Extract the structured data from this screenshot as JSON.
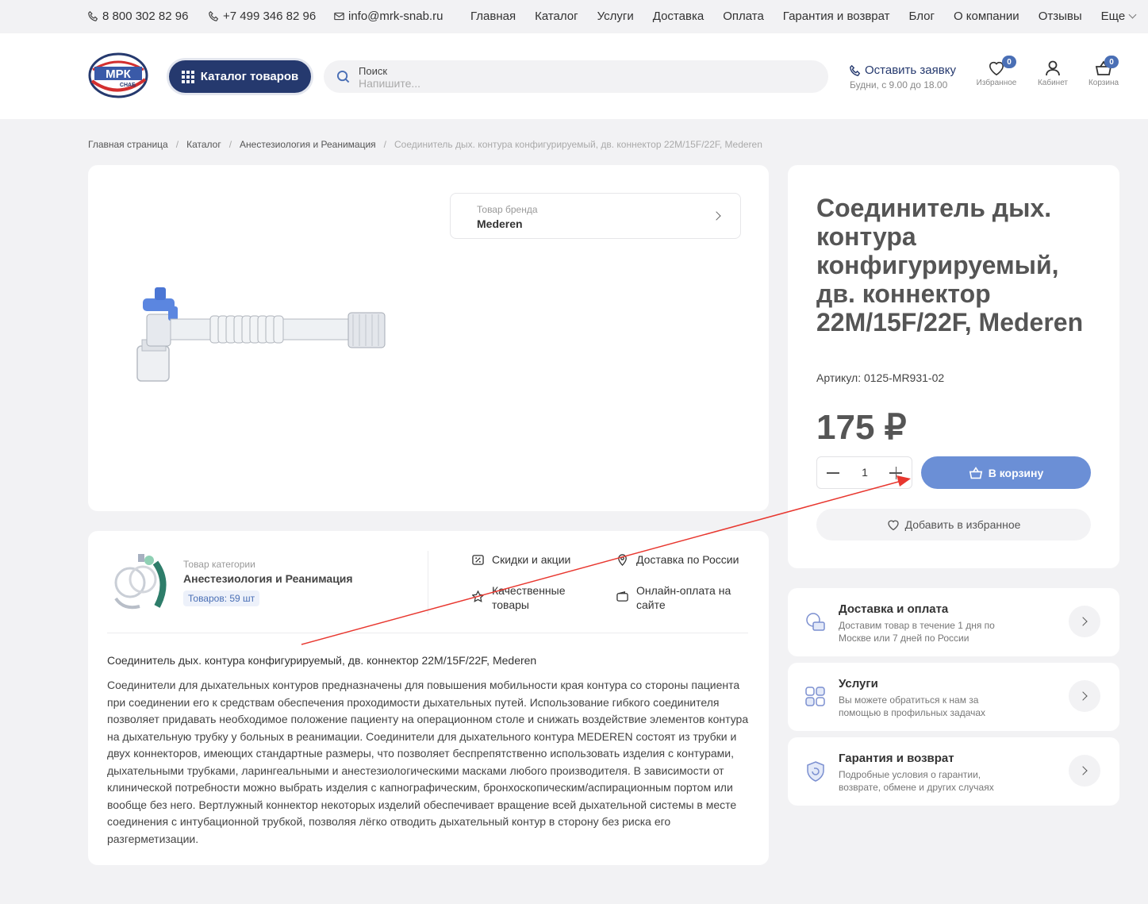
{
  "topbar": {
    "phone1": "8 800 302 82 96",
    "phone2": "+7 499 346 82 96",
    "email": "info@mrk-snab.ru",
    "nav": [
      "Главная",
      "Каталог",
      "Услуги",
      "Доставка",
      "Оплата",
      "Гарантия и возврат",
      "Блог",
      "О компании",
      "Отзывы"
    ],
    "more": "Еще"
  },
  "header": {
    "logo_text_main": "МРК",
    "logo_text_sub": "СНАБ",
    "catalog_button": "Каталог товаров",
    "search_label": "Поиск",
    "search_placeholder": "Напишите...",
    "callback_link": "Оставить заявку",
    "callback_hours": "Будни, с 9.00 до 18.00",
    "favorites_label": "Избранное",
    "favorites_count": "0",
    "account_label": "Кабинет",
    "cart_label": "Корзина",
    "cart_count": "0"
  },
  "breadcrumb": [
    "Главная страница",
    "Каталог",
    "Анестезиология и Реанимация",
    "Соединитель дых. контура конфигурируемый, дв. коннектор 22M/15F/22F, Mederen"
  ],
  "product": {
    "brand_label": "Товар бренда",
    "brand_name": "Mederen",
    "title": "Соединитель дых. контура конфигурируемый, дв. коннектор 22M/15F/22F, Mederen",
    "sku": "Артикул: 0125-MR931-02",
    "price": "175 ₽",
    "quantity": "1",
    "cart_button": "В корзину",
    "favorite_button": "Добавить в избранное"
  },
  "info_cards": [
    {
      "title": "Доставка и оплата",
      "desc": "Доставим товар в течение 1 дня по Москве или 7 дней по России"
    },
    {
      "title": "Услуги",
      "desc": "Вы можете обратиться к нам за помощью в профильных задачах"
    },
    {
      "title": "Гарантия и возврат",
      "desc": "Подробные условия о гарантии, возврате, обмене и других случаях"
    }
  ],
  "category": {
    "label": "Товар категории",
    "name": "Анестезиология и Реанимация",
    "count": "Товаров: 59 шт"
  },
  "features": [
    "Скидки и акции",
    "Доставка по России",
    "Качественные товары",
    "Онлайн-оплата на сайте"
  ],
  "description": {
    "title": "Соединитель дых. контура конфигурируемый, дв. коннектор 22M/15F/22F, Mederen",
    "body": "Соединители для дыхательных контуров предназначены для повышения мобильности края контура со стороны пациента при соединении его к средствам обеспечения проходимости дыхательных путей. Использование гибкого соединителя позволяет придавать необходимое положение пациенту на операционном столе и снижать воздействие элементов контура на дыхательную трубку у больных в реанимации. Соединители для дыхательного контура MEDEREN состоят из трубки и двух коннекторов, имеющих стандартные размеры, что позволяет беспрепятственно использовать изделия с контурами, дыхательными трубками, ларингеальными и анестезиологическими масками любого производителя. В зависимости от клинической потребности можно выбрать изделия с капнографическим, бронхоскопическим/аспирационным портом или вообще без него. Вертлужный коннектор некоторых изделий обеспечивает вращение всей дыхательной системы в месте соединения с интубационной трубкой, позволяя лёгко отводить дыхательный контур в сторону без риска его разгерметизации."
  },
  "colors": {
    "brand_dark": "#25396e",
    "button_blue": "#6b8fd6",
    "annotation_red": "#e8372f"
  }
}
